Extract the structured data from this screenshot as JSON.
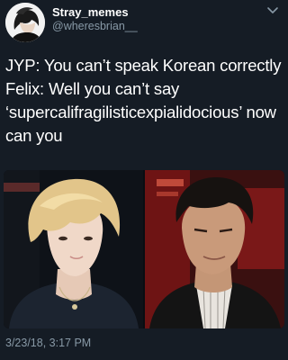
{
  "tweet": {
    "author": {
      "display_name": "Stray_memes",
      "handle": "@wheresbrian__",
      "avatar_icon": "profile-avatar"
    },
    "menu_icon": "chevron-down-icon",
    "text_lines": [
      "JYP: You can’t speak Korean correctly",
      "Felix: Well you can’t say",
      "‘supercalifragilisticexpialidocious’ now",
      "can you"
    ],
    "media": {
      "left_photo": "young-man-blond-hair-photo",
      "right_photo": "man-dark-hair-suit-photo"
    },
    "timestamp": "3/23/18, 3:17 PM",
    "colors": {
      "background": "#151c25",
      "text": "#ffffff",
      "secondary_text": "#8899a6"
    }
  }
}
